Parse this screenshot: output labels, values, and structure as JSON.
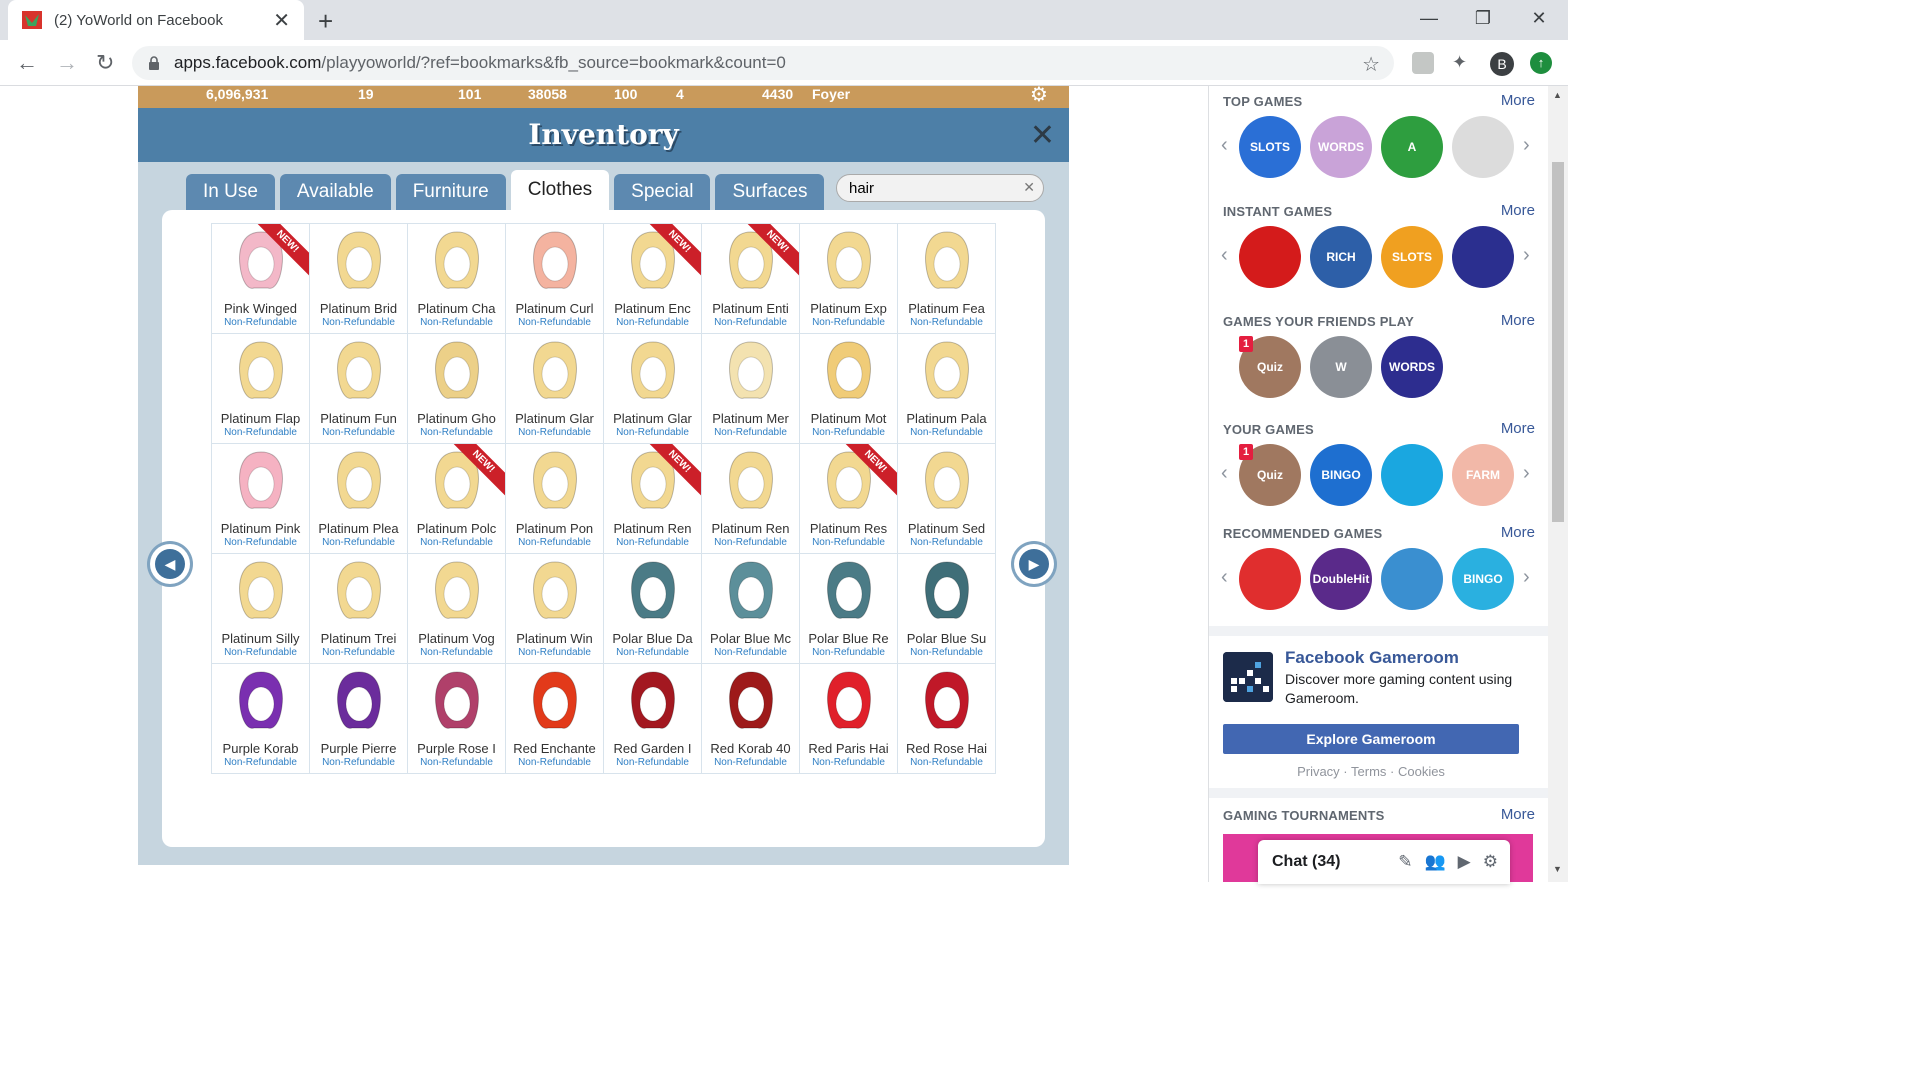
{
  "browser": {
    "tab_title": "(2) YoWorld on Facebook",
    "url_host": "apps.facebook.com",
    "url_path": "/playyoworld/?ref=bookmarks&fb_source=bookmark&count=0",
    "profile_initial": "B"
  },
  "hud": {
    "coins": "6,096,931",
    "cash": "19",
    "level": "101",
    "xp": "38058",
    "energy": "100",
    "hearts": "4",
    "points": "4430",
    "room": "Foyer"
  },
  "inventory": {
    "title": "Inventory",
    "tabs": [
      "In Use",
      "Available",
      "Furniture",
      "Clothes",
      "Special",
      "Surfaces"
    ],
    "active_tab": "Clothes",
    "search_value": "hair",
    "new_label": "NEW!",
    "items": [
      {
        "name": "Pink Winged",
        "note": "Non-Refundable",
        "color": "#f3b8c8",
        "new": true
      },
      {
        "name": "Platinum Brid",
        "note": "Non-Refundable",
        "color": "#f2d891",
        "new": false
      },
      {
        "name": "Platinum Cha",
        "note": "Non-Refundable",
        "color": "#f2d891",
        "new": false
      },
      {
        "name": "Platinum Curl",
        "note": "Non-Refundable",
        "color": "#f4b3a0",
        "new": false
      },
      {
        "name": "Platinum Enc",
        "note": "Non-Refundable",
        "color": "#f2d891",
        "new": true
      },
      {
        "name": "Platinum Enti",
        "note": "Non-Refundable",
        "color": "#f2d891",
        "new": true
      },
      {
        "name": "Platinum Exp",
        "note": "Non-Refundable",
        "color": "#f2d891",
        "new": false
      },
      {
        "name": "Platinum Fea",
        "note": "Non-Refundable",
        "color": "#f2d891",
        "new": false
      },
      {
        "name": "Platinum Flap",
        "note": "Non-Refundable",
        "color": "#f2d891",
        "new": false
      },
      {
        "name": "Platinum Fun",
        "note": "Non-Refundable",
        "color": "#f2d891",
        "new": false
      },
      {
        "name": "Platinum Gho",
        "note": "Non-Refundable",
        "color": "#ecd088",
        "new": false
      },
      {
        "name": "Platinum Glar",
        "note": "Non-Refundable",
        "color": "#f2d891",
        "new": false
      },
      {
        "name": "Platinum Glar",
        "note": "Non-Refundable",
        "color": "#f2d891",
        "new": false
      },
      {
        "name": "Platinum Mer",
        "note": "Non-Refundable",
        "color": "#f3e2b0",
        "new": false
      },
      {
        "name": "Platinum Mot",
        "note": "Non-Refundable",
        "color": "#f0cc78",
        "new": false
      },
      {
        "name": "Platinum Pala",
        "note": "Non-Refundable",
        "color": "#f2d891",
        "new": false
      },
      {
        "name": "Platinum Pink",
        "note": "Non-Refundable",
        "color": "#f5b2c2",
        "new": false
      },
      {
        "name": "Platinum Plea",
        "note": "Non-Refundable",
        "color": "#f2d891",
        "new": false
      },
      {
        "name": "Platinum Polc",
        "note": "Non-Refundable",
        "color": "#f2d891",
        "new": true
      },
      {
        "name": "Platinum Pon",
        "note": "Non-Refundable",
        "color": "#f2d891",
        "new": false
      },
      {
        "name": "Platinum Ren",
        "note": "Non-Refundable",
        "color": "#f2d891",
        "new": true
      },
      {
        "name": "Platinum Ren",
        "note": "Non-Refundable",
        "color": "#f2d891",
        "new": false
      },
      {
        "name": "Platinum Res",
        "note": "Non-Refundable",
        "color": "#f2d891",
        "new": true
      },
      {
        "name": "Platinum Sed",
        "note": "Non-Refundable",
        "color": "#f2d891",
        "new": false
      },
      {
        "name": "Platinum Silly",
        "note": "Non-Refundable",
        "color": "#f2d891",
        "new": false
      },
      {
        "name": "Platinum Trei",
        "note": "Non-Refundable",
        "color": "#f2d891",
        "new": false
      },
      {
        "name": "Platinum Vog",
        "note": "Non-Refundable",
        "color": "#f2d891",
        "new": false
      },
      {
        "name": "Platinum Win",
        "note": "Non-Refundable",
        "color": "#f2d891",
        "new": false
      },
      {
        "name": "Polar Blue Da",
        "note": "Non-Refundable",
        "color": "#4b7b86",
        "new": false
      },
      {
        "name": "Polar Blue Mc",
        "note": "Non-Refundable",
        "color": "#5c8f9a",
        "new": false
      },
      {
        "name": "Polar Blue Re",
        "note": "Non-Refundable",
        "color": "#4b7b86",
        "new": false
      },
      {
        "name": "Polar Blue Su",
        "note": "Non-Refundable",
        "color": "#3f6e78",
        "new": false
      },
      {
        "name": "Purple Korab",
        "note": "Non-Refundable",
        "color": "#7a2fb0",
        "new": false
      },
      {
        "name": "Purple Pierre",
        "note": "Non-Refundable",
        "color": "#6b2c9c",
        "new": false
      },
      {
        "name": "Purple Rose I",
        "note": "Non-Refundable",
        "color": "#b0406a",
        "new": false
      },
      {
        "name": "Red Enchante",
        "note": "Non-Refundable",
        "color": "#e23a1a",
        "new": false
      },
      {
        "name": "Red Garden I",
        "note": "Non-Refundable",
        "color": "#a31820",
        "new": false
      },
      {
        "name": "Red Korab 40",
        "note": "Non-Refundable",
        "color": "#9e1a1a",
        "new": false
      },
      {
        "name": "Red Paris Hai",
        "note": "Non-Refundable",
        "color": "#e0202a",
        "new": false
      },
      {
        "name": "Red Rose Hai",
        "note": "Non-Refundable",
        "color": "#c01828",
        "new": false
      }
    ]
  },
  "sidebar": {
    "sections": [
      {
        "title": "TOP GAMES",
        "more": "More",
        "icons": [
          "#2a6fd6",
          "#c9a3d8",
          "#2e9e3f",
          "#dcdcdc"
        ],
        "labels": [
          "SLOTS",
          "WORDS",
          "A",
          ""
        ]
      },
      {
        "title": "INSTANT GAMES",
        "more": "More",
        "icons": [
          "#d41b1b",
          "#2d5fa8",
          "#f0a020",
          "#2b2f8f"
        ],
        "labels": [
          "",
          "RICH",
          "SLOTS",
          ""
        ]
      },
      {
        "title": "GAMES YOUR FRIENDS PLAY",
        "more": "More",
        "icons": [
          "#a07860",
          "#8a8f96",
          "#2d2d8f"
        ],
        "labels": [
          "Quiz",
          "W",
          "WORDS"
        ]
      },
      {
        "title": "YOUR GAMES",
        "more": "More",
        "icons": [
          "#a07860",
          "#1e6fd0",
          "#1aa7e0",
          "#f2b8a8"
        ],
        "labels": [
          "Quiz",
          "BINGO",
          "",
          "FARM"
        ]
      },
      {
        "title": "RECOMMENDED GAMES",
        "more": "More",
        "icons": [
          "#e02e2e",
          "#5a2a8a",
          "#3a8fd0",
          "#2ab0e0"
        ],
        "labels": [
          "",
          "DoubleHit",
          "",
          "BINGO"
        ]
      }
    ],
    "badge": "1",
    "gameroom": {
      "title": "Facebook Gameroom",
      "description": "Discover more gaming content using Gameroom.",
      "button": "Explore Gameroom"
    },
    "legal": {
      "privacy": "Privacy",
      "terms": "Terms",
      "cookies": "Cookies",
      "sep": " · "
    },
    "tournaments": {
      "title": "GAMING TOURNAMENTS",
      "more": "More"
    }
  },
  "chat": {
    "label": "Chat (34)"
  }
}
